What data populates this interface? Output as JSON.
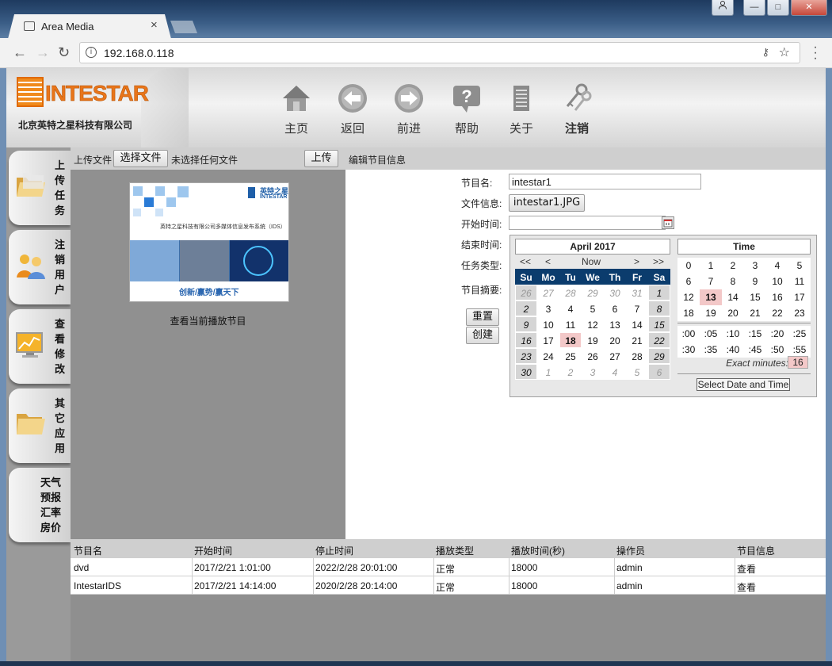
{
  "browser": {
    "tab_title": "Area Media",
    "tab_close": "×",
    "url": "192.168.0.118",
    "window_buttons": [
      "user",
      "minimize",
      "maximize",
      "close"
    ]
  },
  "header": {
    "logo_text": "INTESTAR",
    "logo_subtitle": "北京英特之星科技有限公司",
    "nav": [
      {
        "label": "主页",
        "icon": "home-icon"
      },
      {
        "label": "返回",
        "icon": "back-icon"
      },
      {
        "label": "前进",
        "icon": "forward-icon"
      },
      {
        "label": "帮助",
        "icon": "help-icon"
      },
      {
        "label": "关于",
        "icon": "document-icon"
      },
      {
        "label": "注销",
        "icon": "keys-icon"
      }
    ]
  },
  "sidebar": {
    "items": [
      {
        "label": "上传任务",
        "icon": "folder-icon"
      },
      {
        "label": "注销用户",
        "icon": "users-icon"
      },
      {
        "label": "查看修改",
        "icon": "chart-monitor-icon"
      },
      {
        "label": "其它应用",
        "icon": "folder-icon"
      },
      {
        "label": "天气预报汇率房价",
        "icon": ""
      }
    ]
  },
  "upload": {
    "label": "上传文件",
    "choose_button": "选择文件",
    "no_file": "未选择任何文件",
    "upload_button": "上传",
    "view_current": "查看当前播放节目",
    "thumbnail": {
      "brand_cn": "英特之星",
      "brand_en": "INTESTAR",
      "caption": "英特之星科技有限公司多媒体信息发布系统（IDS）",
      "slogan": "创新/赢势/赢天下"
    }
  },
  "edit": {
    "title": "编辑节目信息",
    "program_name_label": "节目名:",
    "program_name_value": "intestar1",
    "file_info_label": "文件信息:",
    "file_info_value": "intestar1.JPG",
    "start_time_label": "开始时间:",
    "end_time_label": "结束时间:",
    "task_type_label": "任务类型:",
    "summary_label": "节目摘要:",
    "reset_button": "重置",
    "create_button": "创建"
  },
  "calendar": {
    "month": "April 2017",
    "nav": [
      "<<",
      "<",
      "Now",
      ">",
      ">>"
    ],
    "weekdays": [
      "Su",
      "Mo",
      "Tu",
      "We",
      "Th",
      "Fr",
      "Sa"
    ],
    "weeks": [
      [
        "26",
        "27",
        "28",
        "29",
        "30",
        "31",
        "1"
      ],
      [
        "2",
        "3",
        "4",
        "5",
        "6",
        "7",
        "8"
      ],
      [
        "9",
        "10",
        "11",
        "12",
        "13",
        "14",
        "15"
      ],
      [
        "16",
        "17",
        "18",
        "19",
        "20",
        "21",
        "22"
      ],
      [
        "23",
        "24",
        "25",
        "26",
        "27",
        "28",
        "29"
      ],
      [
        "30",
        "1",
        "2",
        "3",
        "4",
        "5",
        "6"
      ]
    ],
    "selected_day": "18",
    "time_title": "Time",
    "hours": [
      [
        "0",
        "1",
        "2",
        "3",
        "4",
        "5"
      ],
      [
        "6",
        "7",
        "8",
        "9",
        "10",
        "11"
      ],
      [
        "12",
        "13",
        "14",
        "15",
        "16",
        "17"
      ],
      [
        "18",
        "19",
        "20",
        "21",
        "22",
        "23"
      ]
    ],
    "selected_hour": "13",
    "minutes": [
      [
        ":00",
        ":05",
        ":10",
        ":15",
        ":20",
        ":25"
      ],
      [
        ":30",
        ":35",
        ":40",
        ":45",
        ":50",
        ":55"
      ]
    ],
    "exact_label": "Exact minutes:",
    "exact_value": "16",
    "select_button": "Select Date and Time"
  },
  "table": {
    "headers": [
      "节目名",
      "开始时间",
      "停止时间",
      "播放类型",
      "播放时间(秒)",
      "操作员",
      "节目信息"
    ],
    "rows": [
      [
        "dvd",
        "2017/2/21 1:01:00",
        "2022/2/28 20:01:00",
        "正常",
        "18000",
        "admin",
        "查看"
      ],
      [
        "IntestarIDS",
        "2017/2/21 14:14:00",
        "2020/2/28 20:14:00",
        "正常",
        "18000",
        "admin",
        "查看"
      ]
    ]
  }
}
